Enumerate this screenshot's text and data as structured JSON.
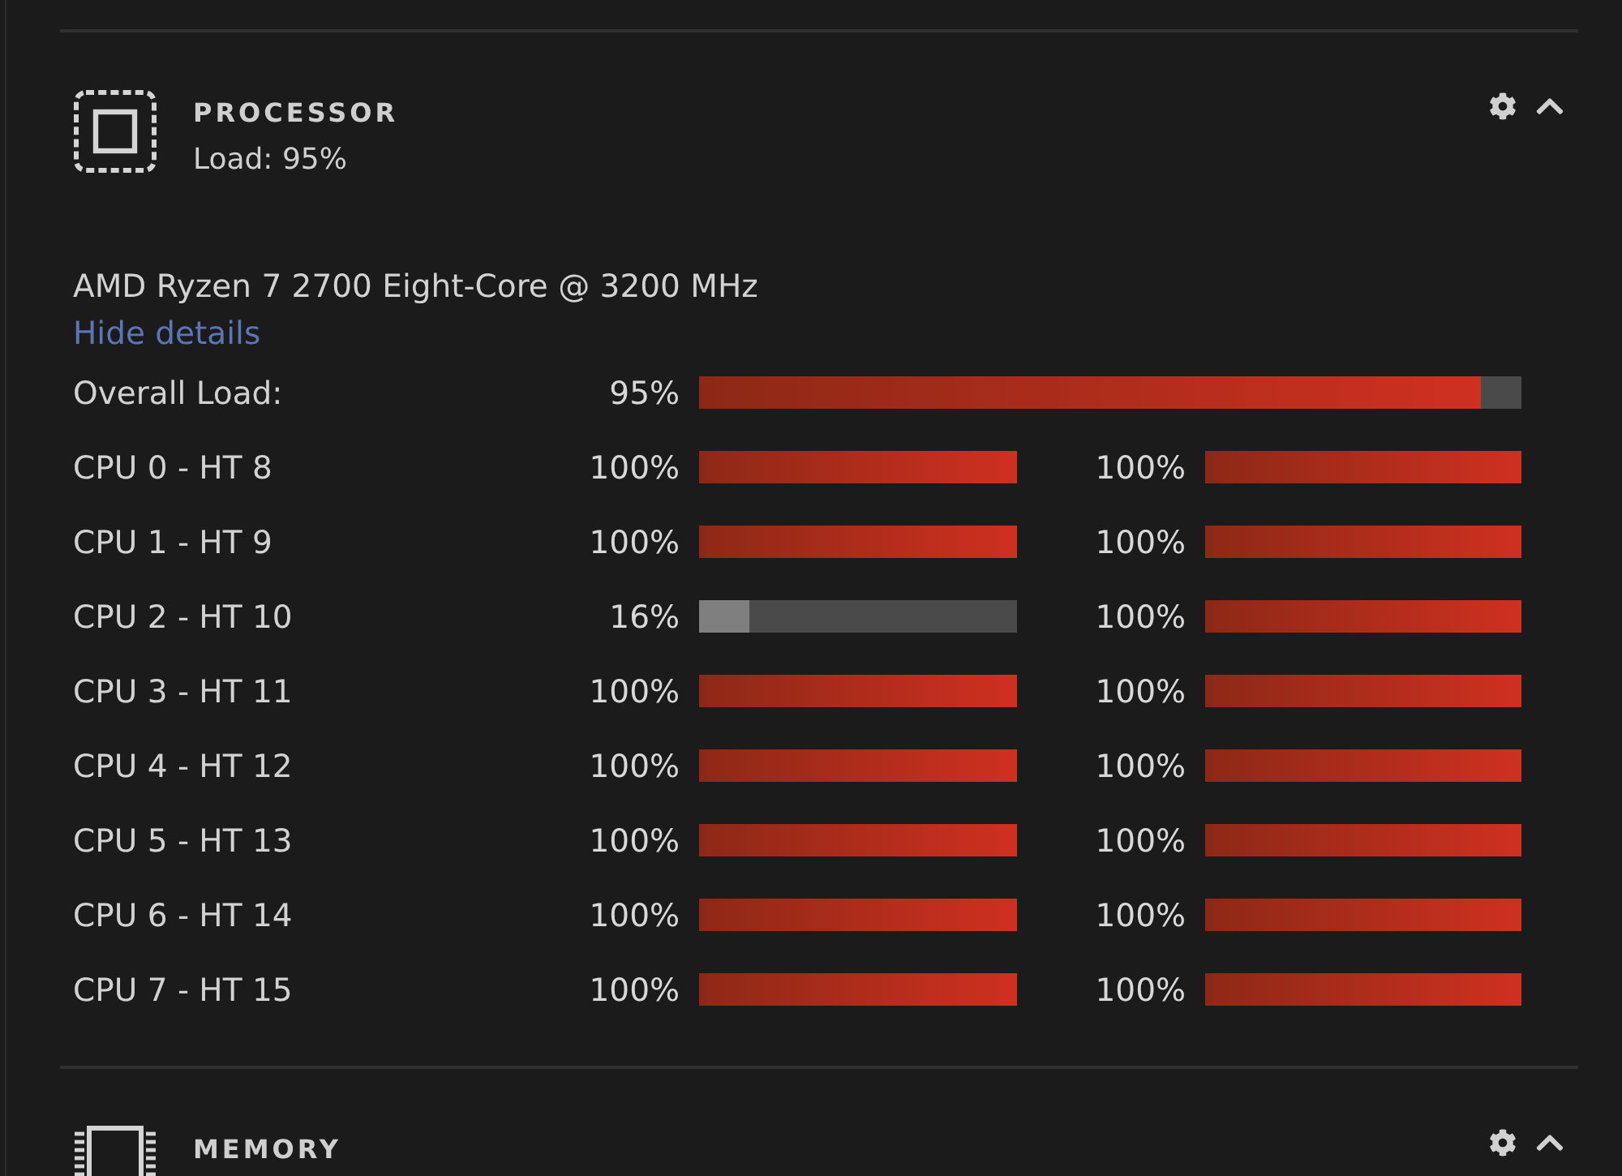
{
  "sections": [
    {
      "kind": "processor",
      "title": "PROCESSOR",
      "subtitle": "Load: 95%",
      "expanded": true,
      "details": {
        "model": "AMD Ryzen 7 2700 Eight-Core @ 3200 MHz",
        "toggle": "Hide details",
        "overall": {
          "label": "Overall Load:",
          "reading": "95%",
          "level": 0.95
        },
        "cores": [
          {
            "label": "CPU 0 - HT 8",
            "threads": [
              {
                "reading": "100%",
                "level": 1
              },
              {
                "reading": "100%",
                "level": 1
              }
            ]
          },
          {
            "label": "CPU 1 - HT 9",
            "threads": [
              {
                "reading": "100%",
                "level": 1
              },
              {
                "reading": "100%",
                "level": 1
              }
            ]
          },
          {
            "label": "CPU 2 - HT 10",
            "threads": [
              {
                "reading": "16%",
                "level": 0.16
              },
              {
                "reading": "100%",
                "level": 1
              }
            ]
          },
          {
            "label": "CPU 3 - HT 11",
            "threads": [
              {
                "reading": "100%",
                "level": 1
              },
              {
                "reading": "100%",
                "level": 1
              }
            ]
          },
          {
            "label": "CPU 4 - HT 12",
            "threads": [
              {
                "reading": "100%",
                "level": 1
              },
              {
                "reading": "100%",
                "level": 1
              }
            ]
          },
          {
            "label": "CPU 5 - HT 13",
            "threads": [
              {
                "reading": "100%",
                "level": 1
              },
              {
                "reading": "100%",
                "level": 1
              }
            ]
          },
          {
            "label": "CPU 6 - HT 14",
            "threads": [
              {
                "reading": "100%",
                "level": 1
              },
              {
                "reading": "100%",
                "level": 1
              }
            ]
          },
          {
            "label": "CPU 7 - HT 15",
            "threads": [
              {
                "reading": "100%",
                "level": 1
              },
              {
                "reading": "100%",
                "level": 1
              }
            ]
          }
        ]
      }
    },
    {
      "kind": "memory",
      "title": "MEMORY",
      "expanded": true
    }
  ]
}
